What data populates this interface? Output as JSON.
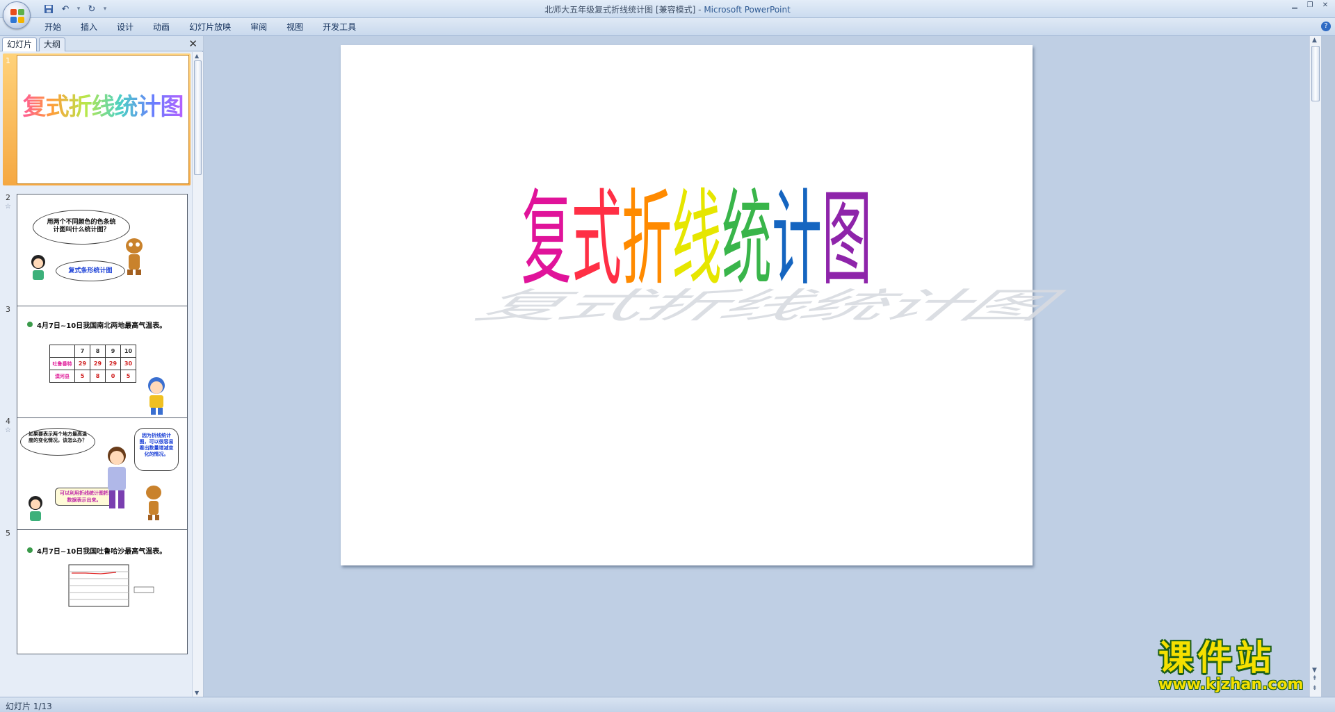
{
  "window": {
    "title": "北师大五年级复式折线统计图 [兼容模式] - ",
    "app_name": "Microsoft PowerPoint"
  },
  "qat": {
    "save_icon": "save-icon",
    "undo_icon": "undo-icon",
    "redo_icon": "redo-icon",
    "customize_icon": "dropdown-icon"
  },
  "ribbon": {
    "tabs": [
      {
        "label": "开始"
      },
      {
        "label": "插入"
      },
      {
        "label": "设计"
      },
      {
        "label": "动画"
      },
      {
        "label": "幻灯片放映"
      },
      {
        "label": "审阅"
      },
      {
        "label": "视图"
      },
      {
        "label": "开发工具"
      }
    ]
  },
  "panel": {
    "tab_slides": "幻灯片",
    "tab_outline": "大纲",
    "slides": [
      {
        "number": "1",
        "title": "复式折线统计图"
      },
      {
        "number": "2",
        "bubble1": "用两个不同颜色的色条统计图叫什么统计图？",
        "bubble2": "复式条形统计图"
      },
      {
        "number": "3",
        "heading": "4月7日~10日我国南北两地最高气温表。",
        "table_header": [
          "7",
          "8",
          "9",
          "10"
        ],
        "row1_label": "吐鲁番特",
        "row1": [
          "29",
          "29",
          "29",
          "30"
        ],
        "row2_label": "漠河县",
        "row2": [
          "5",
          "8",
          "0",
          "5"
        ]
      },
      {
        "number": "4",
        "bubble1": "如果要表示两个地方最高温度的变化情况，该怎么办？",
        "bubble2": "因为折线统计图，可以很容易看出数量增减变化的情况。",
        "bubble3": "可以利用折线统计图把数据表示出来。"
      },
      {
        "number": "5",
        "heading": "4月7日~10日我国吐鲁哈沙最高气温表。"
      }
    ]
  },
  "slide": {
    "title_chars": [
      "复",
      "式",
      "折",
      "线",
      "统",
      "计",
      "图"
    ],
    "title_colors": [
      "#e0139a",
      "#ff2f45",
      "#ff8a00",
      "#e6e600",
      "#39b54a",
      "#1565c0",
      "#8e24aa"
    ]
  },
  "watermark": {
    "title": "课件站",
    "url": "www.kjzhan.com"
  },
  "status": {
    "text": "幻灯片 1/13"
  }
}
